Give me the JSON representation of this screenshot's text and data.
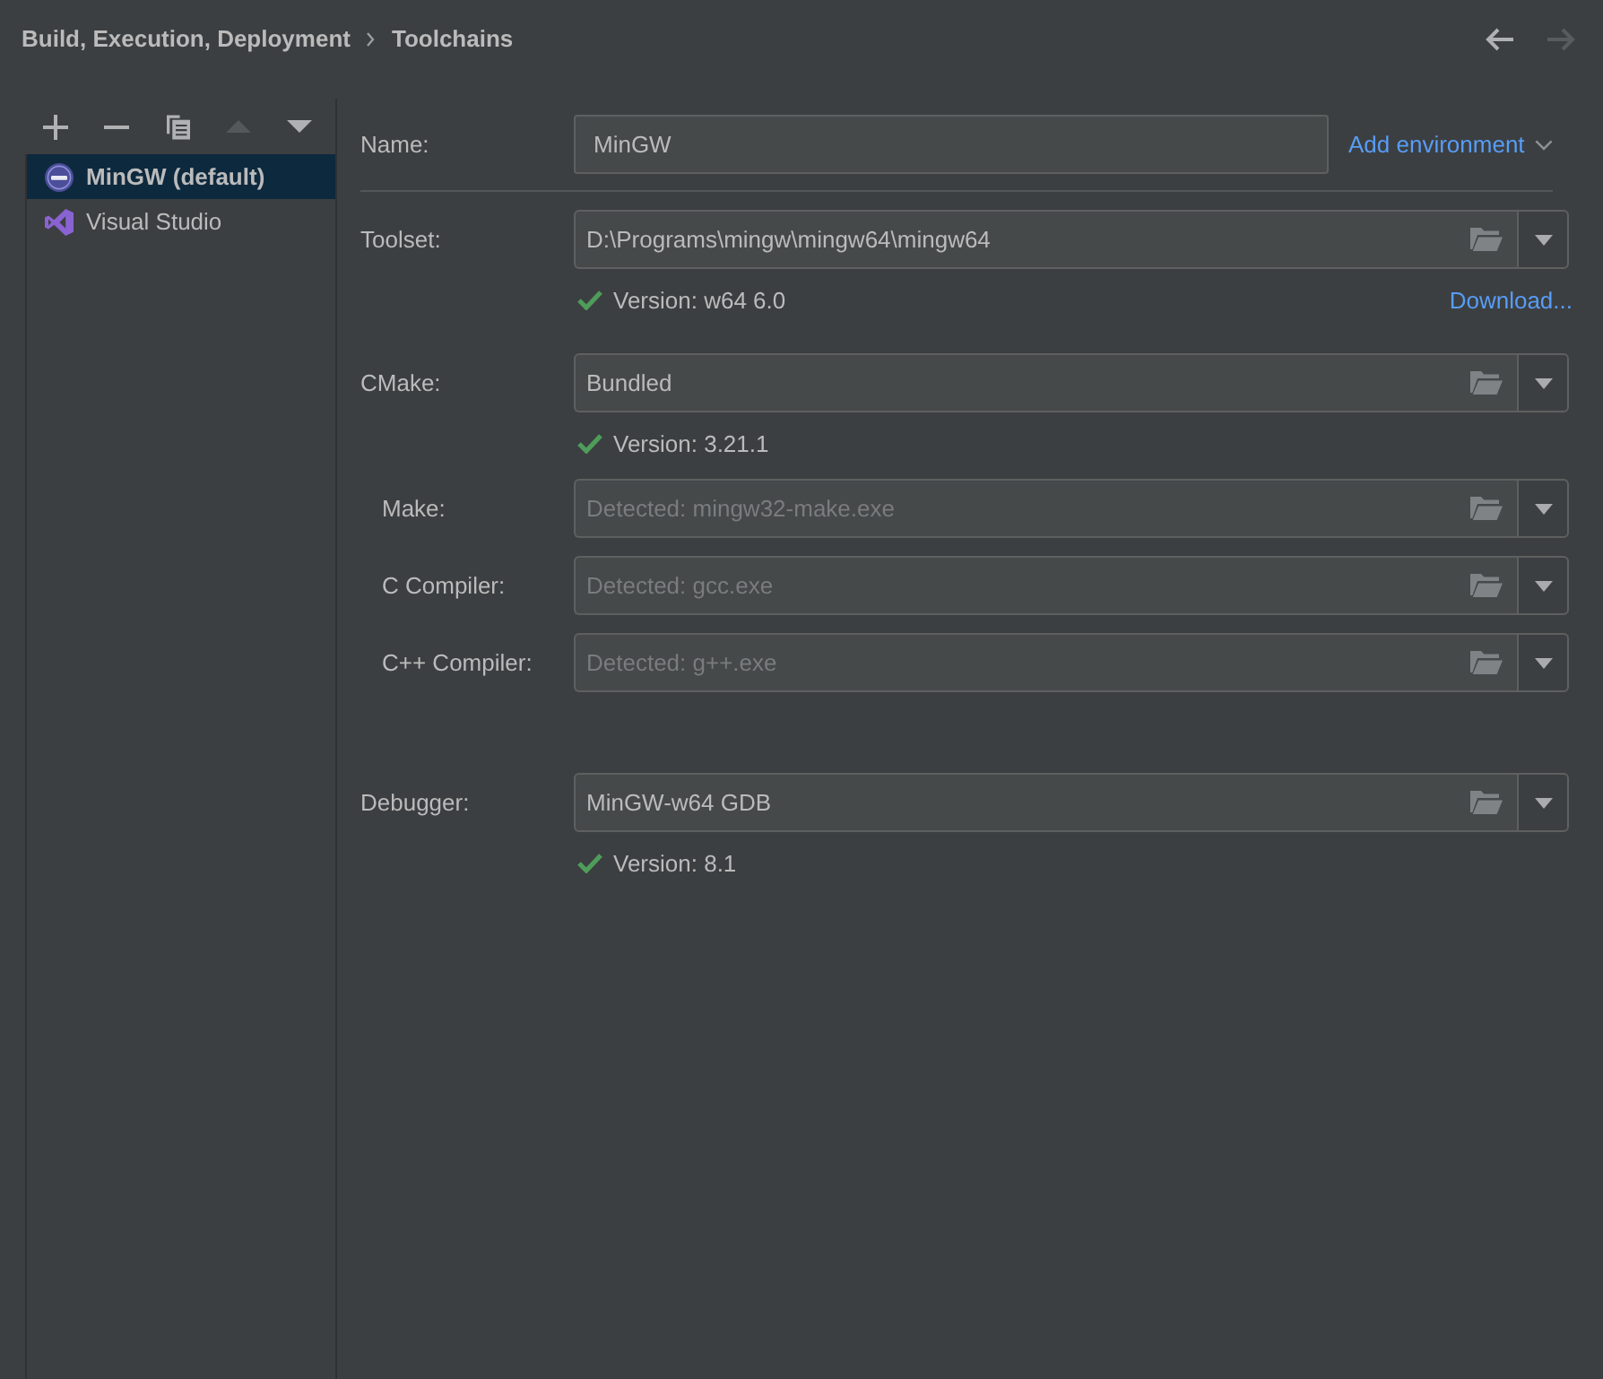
{
  "header": {
    "breadcrumb": [
      {
        "label": "Build, Execution, Deployment"
      },
      {
        "label": "Toolchains"
      }
    ],
    "nav": [
      {
        "kind": "back",
        "disabled": false
      },
      {
        "kind": "forward",
        "disabled": true
      }
    ]
  },
  "toolbar": [
    {
      "kind": "add",
      "disabled": false
    },
    {
      "kind": "remove",
      "disabled": false
    },
    {
      "kind": "copy",
      "disabled": false
    },
    {
      "kind": "move_up",
      "disabled": true
    },
    {
      "kind": "move_down",
      "disabled": false
    }
  ],
  "toolchains": [
    {
      "label": "MinGW (default)",
      "kind": "gnu",
      "default": true,
      "selected": true
    },
    {
      "label": "Visual Studio",
      "kind": "visual_studio",
      "default": false,
      "selected": false
    }
  ],
  "form": {
    "name": {
      "label": "Name:",
      "value": "MinGW"
    },
    "add_environment": {
      "label": "Add environment"
    },
    "rows": [
      {
        "label": "Toolset:",
        "value": "D:\\Programs\\mingw\\mingw64\\mingw64",
        "status": {
          "valid": true,
          "text": "Version: w64 6.0"
        },
        "link": "Download..."
      },
      {
        "label": "CMake:",
        "value": "Bundled",
        "status": {
          "valid": true,
          "text": "Version: 3.21.1"
        },
        "children": [
          {
            "label": "Make:",
            "placeholder": "Detected: mingw32-make.exe"
          },
          {
            "label": "C Compiler:",
            "placeholder": "Detected: gcc.exe"
          },
          {
            "label": "C++ Compiler:",
            "placeholder": "Detected: g++.exe"
          }
        ]
      },
      {
        "label": "Debugger:",
        "value": "MinGW-w64 GDB",
        "status": {
          "valid": true,
          "text": "Version: 8.1"
        }
      }
    ]
  }
}
